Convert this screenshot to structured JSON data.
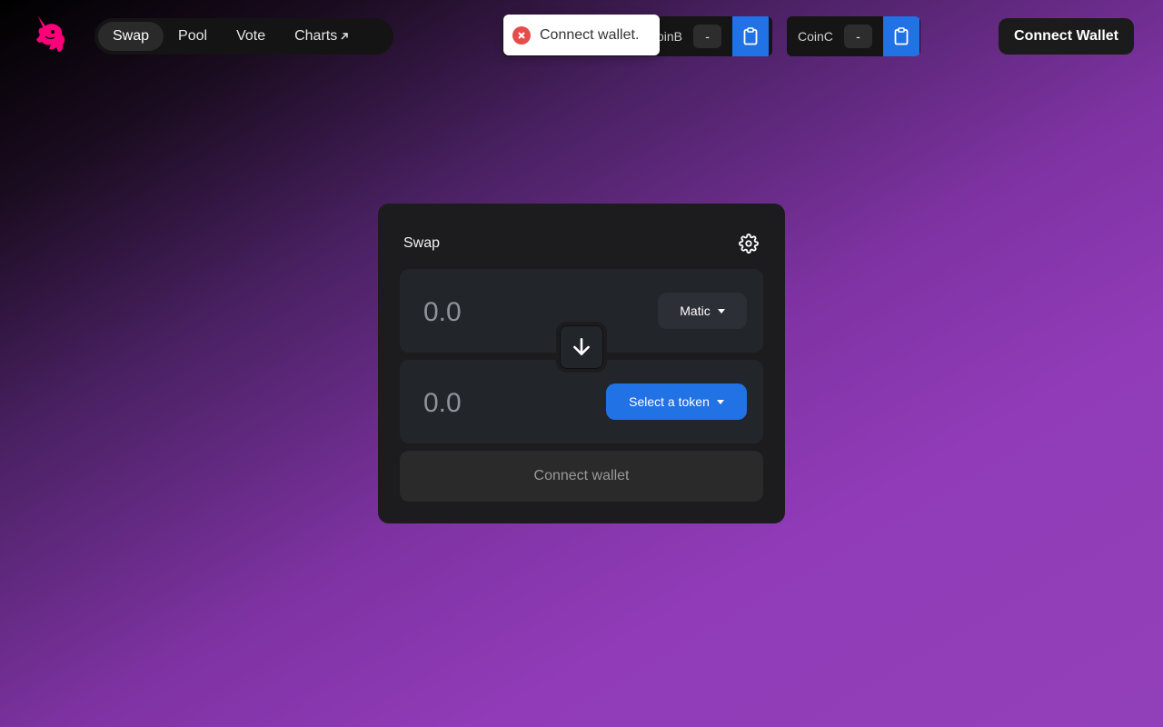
{
  "nav": {
    "items": [
      {
        "label": "Swap",
        "active": true
      },
      {
        "label": "Pool",
        "active": false
      },
      {
        "label": "Vote",
        "active": false
      },
      {
        "label": "Charts",
        "active": false
      }
    ],
    "charts_icon": "arrow-up-right-icon"
  },
  "coins": {
    "coin_b": {
      "label": "CoinB",
      "visible_label": "oinB",
      "value": "-"
    },
    "coin_c": {
      "label": "CoinC",
      "value": "-"
    }
  },
  "toast": {
    "message": "Connect wallet.",
    "icon": "error-circle-icon",
    "color": "#e74c4c"
  },
  "header": {
    "connect_label": "Connect Wallet"
  },
  "swap": {
    "title": "Swap",
    "from": {
      "amount": "0.0",
      "token": "Matic"
    },
    "to": {
      "amount": "0.0",
      "token_button": "Select a token"
    },
    "connect_label": "Connect wallet"
  },
  "colors": {
    "accent": "#2172e5",
    "logo": "#ff007a",
    "error": "#e74c4c"
  }
}
